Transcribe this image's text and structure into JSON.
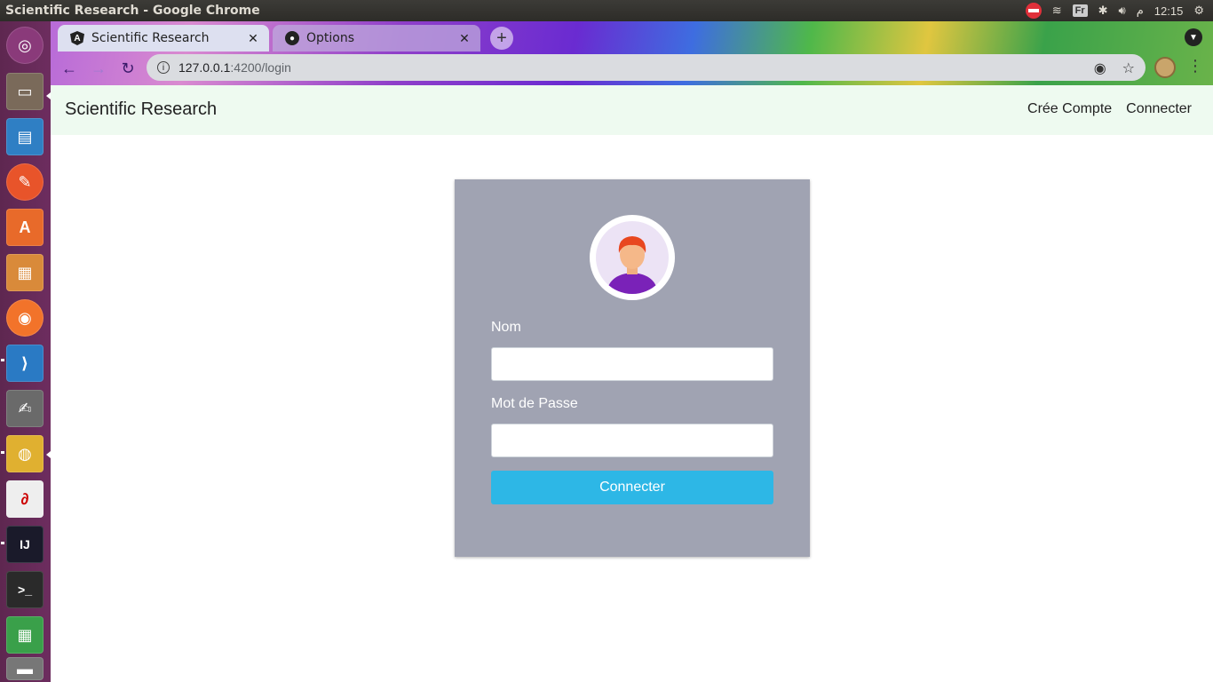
{
  "os": {
    "window_title": "Scientific Research - Google Chrome",
    "keyboard_layout": "Fr",
    "am_pm": "م",
    "clock": "12:15"
  },
  "browser": {
    "tabs": [
      {
        "label": "Scientific Research",
        "icon": "angular-icon",
        "active": true
      },
      {
        "label": "Options",
        "icon": "github-icon",
        "active": false
      }
    ],
    "url_host": "127.0.0.1",
    "url_path": ":4200/login"
  },
  "app": {
    "brand": "Scientific Research",
    "nav_links": [
      "Crée Compte",
      "Connecter"
    ]
  },
  "login": {
    "name_label": "Nom",
    "name_value": "",
    "password_label": "Mot de Passe",
    "password_value": "",
    "submit_label": "Connecter"
  },
  "colors": {
    "navbar_bg": "#eefaf0",
    "card_bg": "#a0a3b2",
    "button_bg": "#2db7e6",
    "launcher_bg": "#5e2750"
  }
}
